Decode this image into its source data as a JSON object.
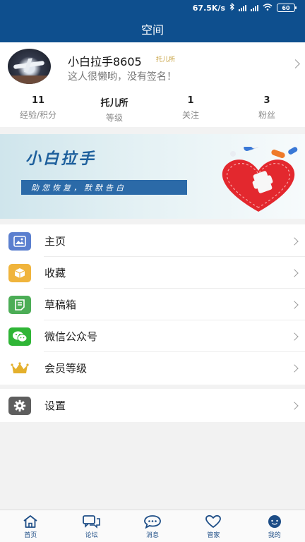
{
  "status_bar": {
    "speed": "67.5K/s",
    "battery": "60"
  },
  "header": {
    "title": "空间"
  },
  "profile": {
    "username": "小白拉手8605",
    "level_tag": "托儿所",
    "signature": "这人很懒哟，没有签名！",
    "stats": [
      {
        "value": "11",
        "label": "经验/积分"
      },
      {
        "value": "托儿所",
        "label": "等级"
      },
      {
        "value": "1",
        "label": "关注"
      },
      {
        "value": "3",
        "label": "粉丝"
      }
    ]
  },
  "banner": {
    "title": "小白拉手",
    "slogan": "助您恢复，默默告白"
  },
  "menu": {
    "items": [
      {
        "label": "主页",
        "icon": "image-icon",
        "color": "#5b7fcf"
      },
      {
        "label": "收藏",
        "icon": "box-icon",
        "color": "#f0b43c"
      },
      {
        "label": "草稿箱",
        "icon": "note-icon",
        "color": "#4cad56"
      },
      {
        "label": "微信公众号",
        "icon": "wechat-icon",
        "color": "#2fb536"
      },
      {
        "label": "会员等级",
        "icon": "crown-icon",
        "color": "#e4b02c"
      }
    ],
    "settings": {
      "label": "设置",
      "icon": "gear-icon",
      "color": "#5e5e5e"
    }
  },
  "tabbar": {
    "tabs": [
      {
        "label": "首页",
        "icon": "home-icon"
      },
      {
        "label": "论坛",
        "icon": "forum-icon"
      },
      {
        "label": "消息",
        "icon": "message-icon"
      },
      {
        "label": "管家",
        "icon": "heart-icon"
      },
      {
        "label": "我的",
        "icon": "profile-icon"
      }
    ],
    "active_color": "#1d4d86"
  }
}
